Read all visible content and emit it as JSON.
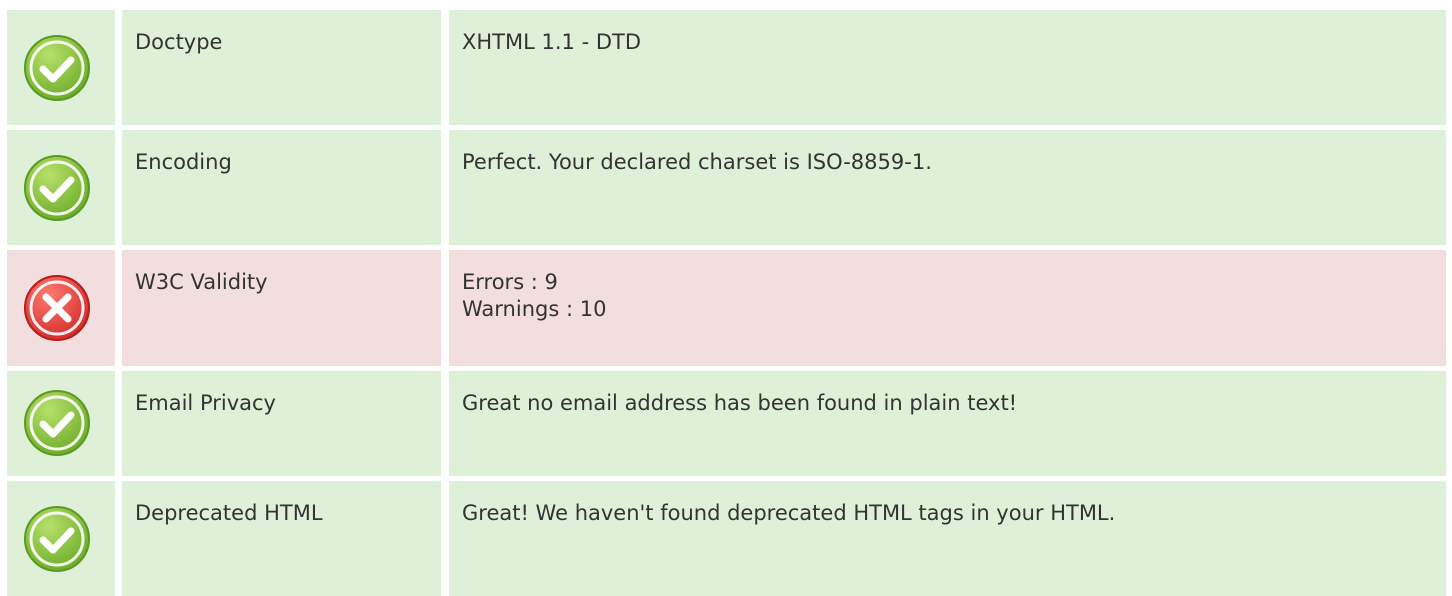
{
  "rows": [
    {
      "status": "pass",
      "icon": "check-circle-icon",
      "label": "Doctype",
      "value": "XHTML 1.1 - DTD"
    },
    {
      "status": "pass",
      "icon": "check-circle-icon",
      "label": "Encoding",
      "value": "Perfect. Your declared charset is ISO-8859-1."
    },
    {
      "status": "fail",
      "icon": "x-circle-icon",
      "label": "W3C Validity",
      "value_lines": [
        "Errors : 9",
        "Warnings : 10"
      ]
    },
    {
      "status": "pass",
      "icon": "check-circle-icon",
      "label": "Email Privacy",
      "value": "Great no email address has been found in plain text!"
    },
    {
      "status": "pass",
      "icon": "check-circle-icon",
      "label": "Deprecated HTML",
      "value": "Great! We haven't found deprecated HTML tags in your HTML."
    }
  ],
  "colors": {
    "pass_bg": "#dff0d8",
    "fail_bg": "#f2dede",
    "pass_icon": "#8cc63f",
    "fail_icon": "#e53935"
  }
}
